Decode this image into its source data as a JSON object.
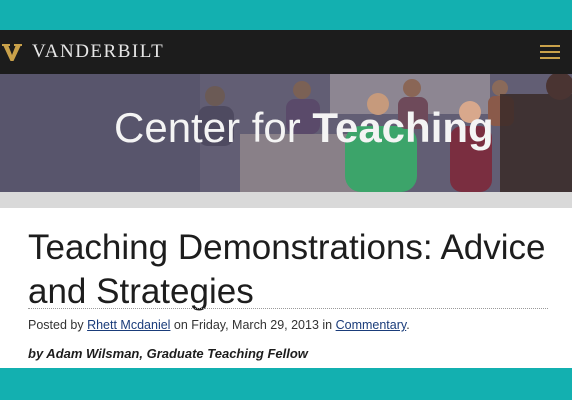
{
  "header": {
    "brand": "VANDERBILT",
    "logo_icon": "vanderbilt-v-icon",
    "menu_icon": "hamburger-menu-icon",
    "accent_color": "#c9a14a"
  },
  "hero": {
    "title_light": "Center for ",
    "title_bold": "Teaching"
  },
  "article": {
    "title": "Teaching Demonstrations: Advice and Strategies",
    "meta": {
      "posted_by": "Posted by ",
      "author_link": "Rhett Mcdaniel",
      "on_date": " on Friday, March 29, 2013 in ",
      "category_link": "Commentary",
      "end": "."
    },
    "byline": "by Adam Wilsman, Graduate Teaching Fellow"
  },
  "colors": {
    "frame": "#13b0b0",
    "navbar": "#1c1c1c",
    "link": "#1a3c7a"
  }
}
